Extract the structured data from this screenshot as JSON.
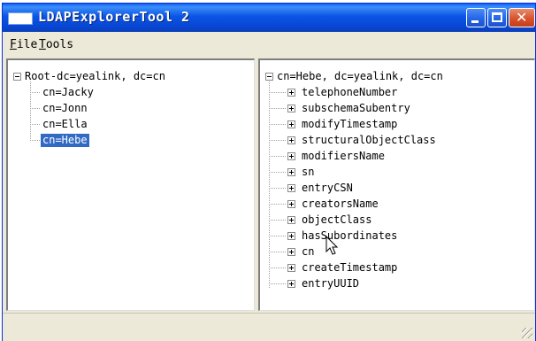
{
  "window": {
    "title": "LDAPExplorerTool 2",
    "title_color": "#ffffff",
    "titlebar_color": "#0b55e5"
  },
  "menu": {
    "file": {
      "accel": "F",
      "rest": "ile"
    },
    "tools": {
      "accel": "T",
      "rest": "ools"
    }
  },
  "left_tree": {
    "root": {
      "label": "Root-dc=yealink, dc=cn",
      "expanded": true
    },
    "children": [
      {
        "label": "cn=Jacky",
        "selected": false
      },
      {
        "label": "cn=Jonn",
        "selected": false
      },
      {
        "label": "cn=Ella",
        "selected": false
      },
      {
        "label": "cn=Hebe",
        "selected": true
      }
    ],
    "selection_color": "#316ac5"
  },
  "right_tree": {
    "root": {
      "label": "cn=Hebe, dc=yealink, dc=cn",
      "expanded": true
    },
    "attributes": [
      "telephoneNumber",
      "subschemaSubentry",
      "modifyTimestamp",
      "structuralObjectClass",
      "modifiersName",
      "sn",
      "entryCSN",
      "creatorsName",
      "objectClass",
      "hasSubordinates",
      "cn",
      "createTimestamp",
      "entryUUID"
    ]
  },
  "icons": {
    "app": "app-window-icon",
    "minimize": "minimize-icon",
    "maximize": "maximize-icon",
    "close": "close-icon",
    "close_glyph": "✕",
    "cursor": "mouse-pointer-icon"
  }
}
